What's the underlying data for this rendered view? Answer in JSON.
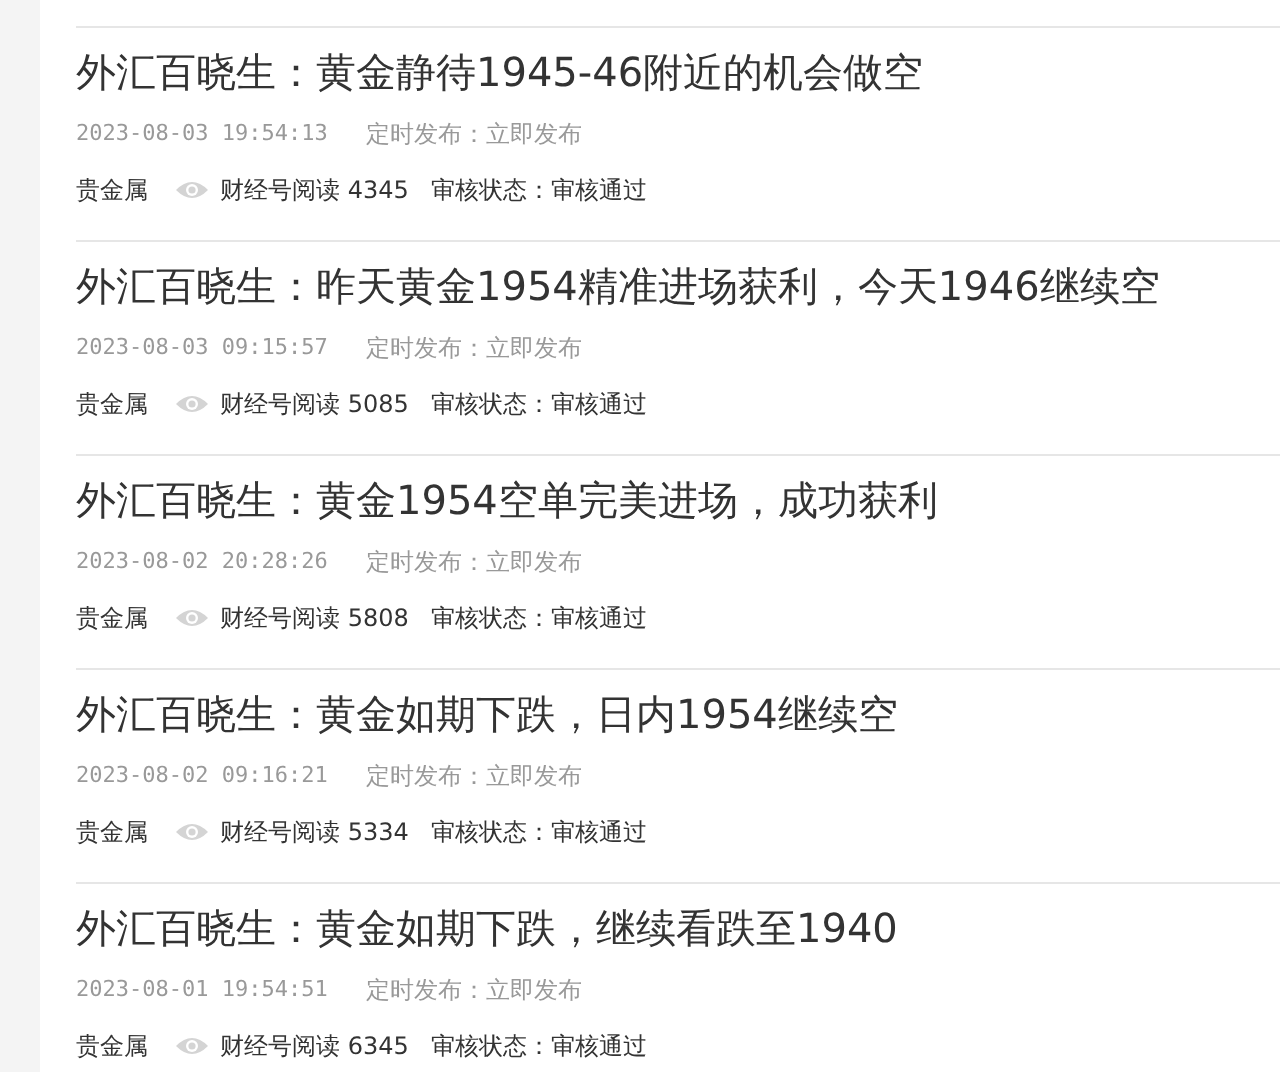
{
  "articles": [
    {
      "title": "外汇百晓生：黄金静待1945-46附近的机会做空",
      "time": "2023-08-03 19:54:13",
      "schedule": "定时发布：立即发布",
      "category": "贵金属",
      "reads": "财经号阅读 4345",
      "review": "审核状态：审核通过"
    },
    {
      "title": "外汇百晓生：昨天黄金1954精准进场获利，今天1946继续空",
      "time": "2023-08-03 09:15:57",
      "schedule": "定时发布：立即发布",
      "category": "贵金属",
      "reads": "财经号阅读 5085",
      "review": "审核状态：审核通过"
    },
    {
      "title": "外汇百晓生：黄金1954空单完美进场，成功获利",
      "time": "2023-08-02 20:28:26",
      "schedule": "定时发布：立即发布",
      "category": "贵金属",
      "reads": "财经号阅读 5808",
      "review": "审核状态：审核通过"
    },
    {
      "title": "外汇百晓生：黄金如期下跌，日内1954继续空",
      "time": "2023-08-02 09:16:21",
      "schedule": "定时发布：立即发布",
      "category": "贵金属",
      "reads": "财经号阅读 5334",
      "review": "审核状态：审核通过"
    },
    {
      "title": "外汇百晓生：黄金如期下跌，继续看跌至1940",
      "time": "2023-08-01 19:54:51",
      "schedule": "定时发布：立即发布",
      "category": "贵金属",
      "reads": "财经号阅读 6345",
      "review": "审核状态：审核通过"
    }
  ]
}
